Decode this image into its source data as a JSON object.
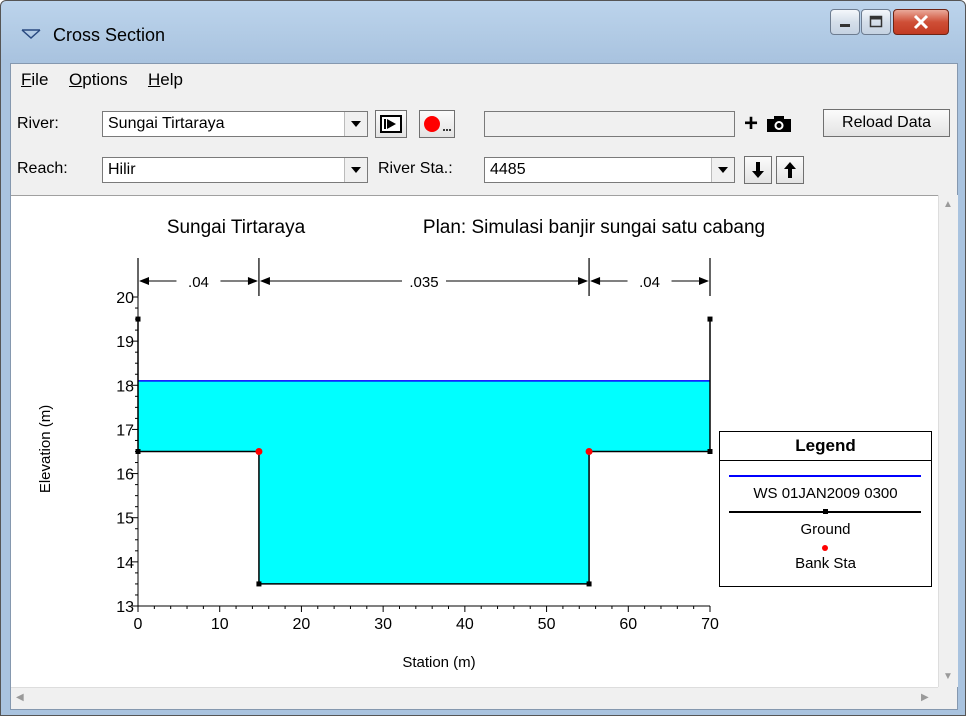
{
  "window": {
    "title": "Cross Section"
  },
  "menu": {
    "file": "File",
    "file_key": "F",
    "file_rest": "ile",
    "options_key": "O",
    "options_rest": "ptions",
    "help_key": "H",
    "help_rest": "elp"
  },
  "toolbar": {
    "river_label": "River:",
    "river_value": "Sungai Tirtaraya",
    "reach_label": "Reach:",
    "reach_value": "Hilir",
    "riversta_label": "River Sta.:",
    "riversta_value": "4485",
    "status_value": "",
    "add_label": "+",
    "reload_label": "Reload Data"
  },
  "colors": {
    "water": "#00ffff",
    "ws_line": "#0000ff",
    "ground": "#000000",
    "bank": "#ff0000"
  },
  "icons": [
    "play-animation-icon",
    "record-icon",
    "camera-icon",
    "down-arrow-icon",
    "up-arrow-icon"
  ],
  "chart_data": {
    "type": "area",
    "title_river": "Sungai Tirtaraya",
    "title_plan": "Plan: Simulasi banjir sungai satu cabang",
    "xlabel": "Station (m)",
    "ylabel": "Elevation (m)",
    "xlim": [
      0,
      70
    ],
    "ylim": [
      13,
      20
    ],
    "xticks": [
      0,
      10,
      20,
      30,
      40,
      50,
      60,
      70
    ],
    "yticks": [
      13,
      14,
      15,
      16,
      17,
      18,
      19,
      20
    ],
    "ground": {
      "x": [
        0,
        0,
        14.8,
        14.8,
        55.2,
        55.2,
        70,
        70
      ],
      "y": [
        19.5,
        16.5,
        16.5,
        13.5,
        13.5,
        16.5,
        16.5,
        19.5
      ]
    },
    "water_surface": 18.1,
    "bank_stations": [
      {
        "x": 14.8,
        "y": 16.5
      },
      {
        "x": 55.2,
        "y": 16.5
      }
    ],
    "manning": [
      {
        "from": 0,
        "to": 14.8,
        "label": ".04"
      },
      {
        "from": 14.8,
        "to": 55.2,
        "label": ".035"
      },
      {
        "from": 55.2,
        "to": 70,
        "label": ".04"
      }
    ],
    "legend": {
      "title": "Legend",
      "ws": "WS 01JAN2009 0300",
      "ground": "Ground",
      "bank": "Bank Sta"
    }
  }
}
